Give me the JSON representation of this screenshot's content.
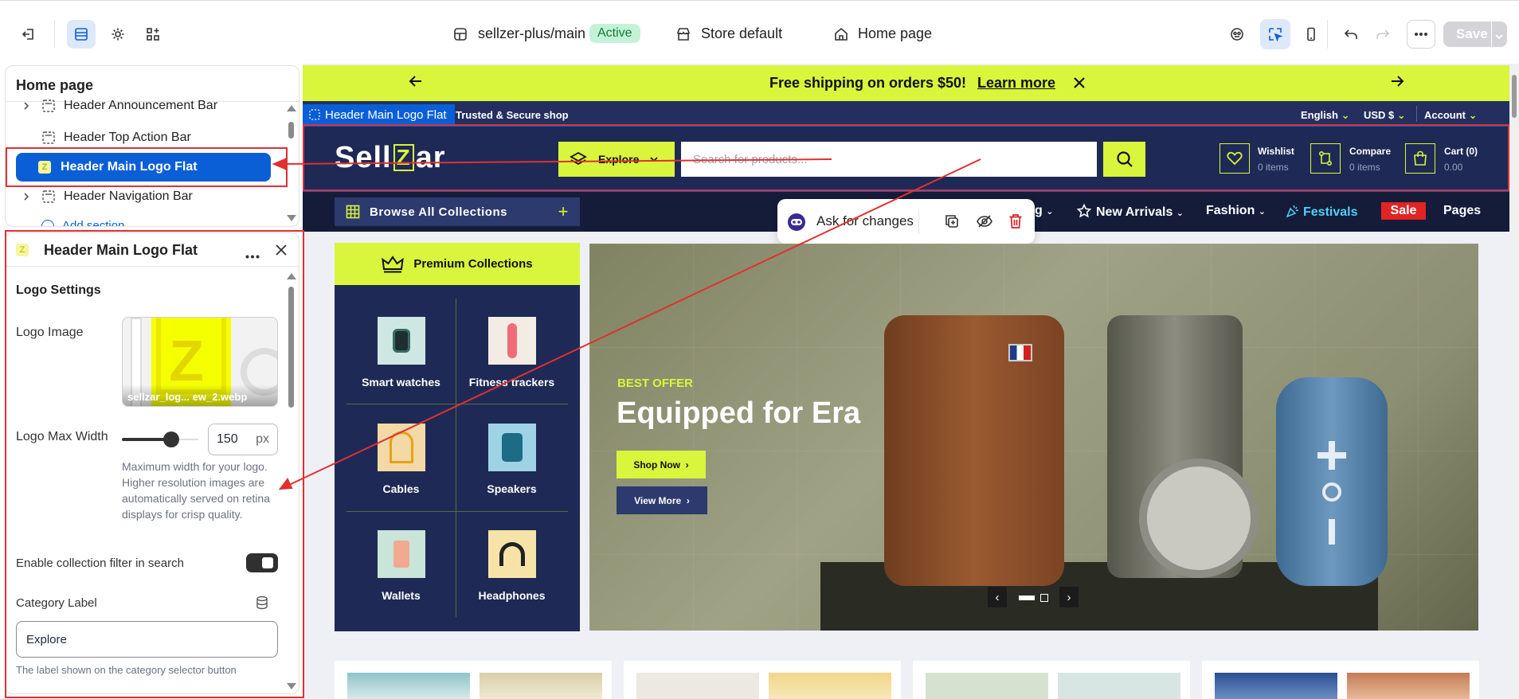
{
  "topbar": {
    "theme_name": "sellzer-plus/main",
    "theme_status": "Active",
    "store_label": "Store default",
    "page_label": "Home page",
    "save_label": "Save"
  },
  "sidebar": {
    "title": "Home page",
    "items": [
      {
        "label": "Header Announcement Bar"
      },
      {
        "label": "Header Top Action Bar"
      },
      {
        "label": "Header Main Logo Flat"
      },
      {
        "label": "Header Navigation Bar"
      }
    ],
    "add_section": "Add section"
  },
  "settings": {
    "title": "Header Main Logo Flat",
    "group_title": "Logo Settings",
    "logo_image_label": "Logo Image",
    "logo_filename": "sellzar_log... ew_2.webp",
    "logo_width_label": "Logo Max Width",
    "logo_width_value": "150",
    "logo_width_unit": "px",
    "logo_width_hint": "Maximum width for your logo. Higher resolution images are automatically served on retina displays for crisp quality.",
    "filter_label": "Enable collection filter in search",
    "filter_enabled": true,
    "category_label": "Category Label",
    "category_value": "Explore",
    "category_hint": "The label shown on the category selector button"
  },
  "preview": {
    "announcement": {
      "text": "Free shipping on orders $50!",
      "link": "Learn more"
    },
    "section_tag": "Header Main Logo Flat",
    "topbar_tagline": "Trusted & Secure shop",
    "topbar_links": [
      "English",
      "USD $",
      "Account"
    ],
    "logo_left": "Sell",
    "logo_mid": "Z",
    "logo_right": "ar",
    "explore_label": "Explore",
    "search_placeholder": "Search for products...",
    "wishlist": {
      "title": "Wishlist",
      "sub": "0 items"
    },
    "compare": {
      "title": "Compare",
      "sub": "0 items"
    },
    "cart": {
      "title": "Cart (0)",
      "sub": "0.00"
    },
    "browse_label": "Browse All Collections",
    "nav": {
      "partial": "g",
      "new_arrivals": "New Arrivals",
      "fashion": "Fashion",
      "festivals": "Festivals",
      "sale": "Sale",
      "pages": "Pages"
    },
    "ask_label": "Ask for changes",
    "collections_title": "Premium Collections",
    "collections": [
      "Smart watches",
      "Fitness trackers",
      "Cables",
      "Speakers",
      "Wallets",
      "Headphones"
    ],
    "hero": {
      "eyebrow": "BEST OFFER",
      "title": "Equipped for Era",
      "primary": "Shop Now",
      "secondary": "View More"
    }
  },
  "colors": {
    "accent": "#d9f53c",
    "navy": "#1e2a55",
    "blue": "#0b5fd6",
    "sale": "#e02424",
    "red_annotation": "#e03030"
  }
}
